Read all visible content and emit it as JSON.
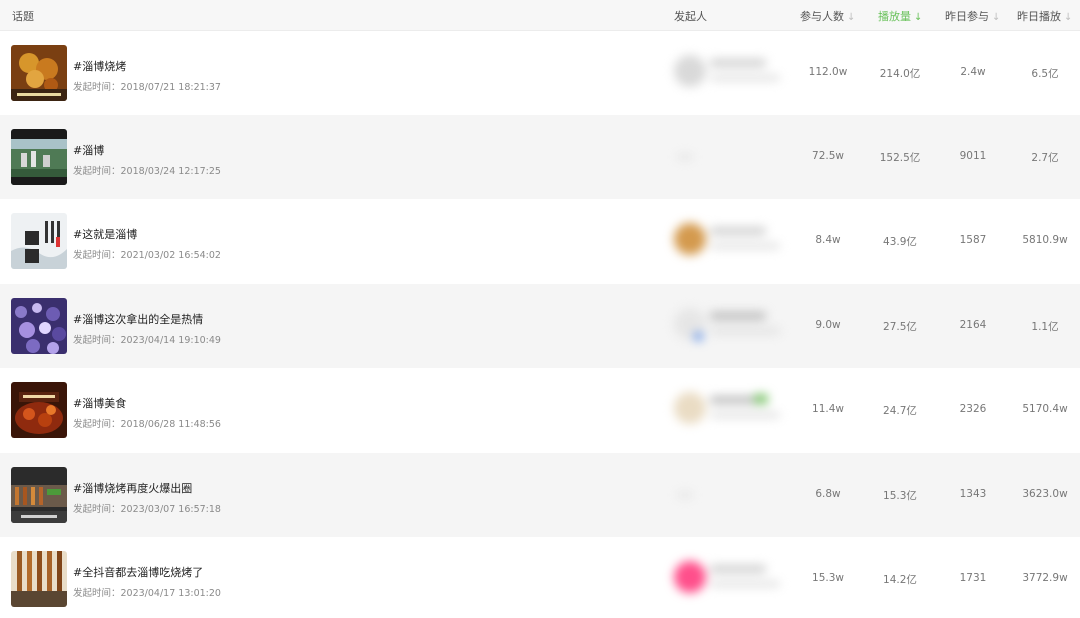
{
  "header": {
    "topic": "话题",
    "initiator": "发起人",
    "participants": "参与人数",
    "plays": "播放量",
    "yesterday_participants": "昨日参与",
    "yesterday_plays": "昨日播放",
    "active_sort_color": "#6ac25b"
  },
  "rows": [
    {
      "title": "#淄博烧烤",
      "time": "发起时间：2018/07/21 18:21:37",
      "participants": "112.0w",
      "plays": "214.0亿",
      "yesterday_participants": "2.4w",
      "yesterday_plays": "6.5亿"
    },
    {
      "title": "#淄博",
      "time": "发起时间：2018/03/24 12:17:25",
      "participants": "72.5w",
      "plays": "152.5亿",
      "yesterday_participants": "9011",
      "yesterday_plays": "2.7亿"
    },
    {
      "title": "#这就是淄博",
      "time": "发起时间：2021/03/02 16:54:02",
      "participants": "8.4w",
      "plays": "43.9亿",
      "yesterday_participants": "1587",
      "yesterday_plays": "5810.9w"
    },
    {
      "title": "#淄博这次拿出的全是热情",
      "time": "发起时间：2023/04/14 19:10:49",
      "participants": "9.0w",
      "plays": "27.5亿",
      "yesterday_participants": "2164",
      "yesterday_plays": "1.1亿"
    },
    {
      "title": "#淄博美食",
      "time": "发起时间：2018/06/28 11:48:56",
      "participants": "11.4w",
      "plays": "24.7亿",
      "yesterday_participants": "2326",
      "yesterday_plays": "5170.4w"
    },
    {
      "title": "#淄博烧烤再度火爆出圈",
      "time": "发起时间：2023/03/07 16:57:18",
      "participants": "6.8w",
      "plays": "15.3亿",
      "yesterday_participants": "1343",
      "yesterday_plays": "3623.0w"
    },
    {
      "title": "#全抖音都去淄博吃烧烤了",
      "time": "发起时间：2023/04/17 13:01:20",
      "participants": "15.3w",
      "plays": "14.2亿",
      "yesterday_participants": "1731",
      "yesterday_plays": "3772.9w"
    }
  ]
}
